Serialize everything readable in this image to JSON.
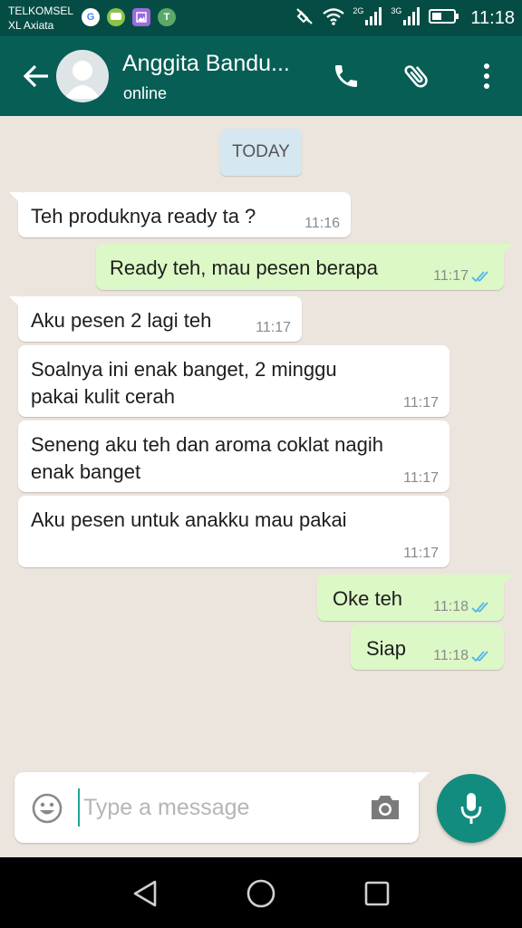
{
  "status_bar": {
    "carrier_1": "TELKOMSEL",
    "carrier_2": "XL Axiata",
    "network_1": "2G",
    "network_2": "3G",
    "time": "11:18",
    "app_icons": [
      {
        "icon": "google-icon",
        "letter": "G",
        "color": "#4285f4"
      },
      {
        "icon": "chat-app-icon",
        "letter": "",
        "color": "#8bc34a"
      },
      {
        "icon": "gallery-app-icon",
        "letter": "",
        "color": "#9c6ade"
      },
      {
        "icon": "tokopedia-icon",
        "letter": "T",
        "color": "#5aa96a"
      }
    ]
  },
  "header": {
    "contact_name": "Anggita Bandu...",
    "status": "online"
  },
  "chat": {
    "day_label": "TODAY",
    "messages": [
      {
        "dir": "in",
        "text": "Teh produknya ready ta ?",
        "time": "11:16"
      },
      {
        "dir": "out",
        "text": "Ready teh, mau pesen berapa",
        "time": "11:17",
        "read": true
      },
      {
        "dir": "in",
        "text": "Aku pesen 2 lagi teh",
        "time": "11:17"
      },
      {
        "dir": "in",
        "text": "Soalnya ini enak banget, 2 minggu\npakai kulit cerah",
        "time": "11:17"
      },
      {
        "dir": "in",
        "text": "Seneng aku teh dan aroma coklat nagih\nenak banget",
        "time": "11:17"
      },
      {
        "dir": "in",
        "text": "Aku pesen untuk anakku mau pakai",
        "time": "11:17"
      },
      {
        "dir": "out",
        "text": "Oke teh",
        "time": "11:18",
        "read": true
      },
      {
        "dir": "out",
        "text": "Siap",
        "time": "11:18",
        "read": true
      }
    ]
  },
  "composer": {
    "placeholder": "Type a message"
  },
  "colors": {
    "header": "#075e54",
    "status_bar": "#054d44",
    "outgoing_bubble": "#dcf8c6",
    "incoming_bubble": "#ffffff",
    "read_ticks": "#4fb6ec",
    "mic_button": "#128c7e"
  }
}
